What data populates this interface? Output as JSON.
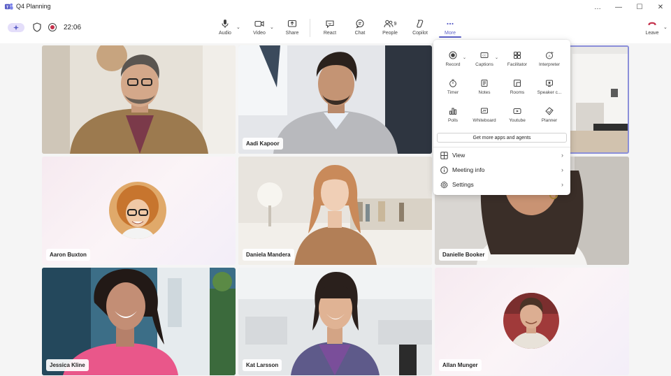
{
  "window": {
    "title": "Q4 Planning",
    "controls": [
      "…",
      "—",
      "☐",
      "✕"
    ]
  },
  "toolbar": {
    "timer": "22:06",
    "audio": "Audio",
    "video": "Video",
    "share": "Share",
    "react": "React",
    "chat": "Chat",
    "people": "People",
    "people_count": "9",
    "copilot": "Copilot",
    "more": "More",
    "leave": "Leave"
  },
  "more_menu": {
    "apps": [
      {
        "label": "Record",
        "icon": "record-icon"
      },
      {
        "label": "Captions",
        "icon": "captions-icon"
      },
      {
        "label": "Facilitator",
        "icon": "facilitator-icon"
      },
      {
        "label": "Interpreter",
        "icon": "interpreter-icon"
      },
      {
        "label": "Timer",
        "icon": "timer-icon"
      },
      {
        "label": "Notes",
        "icon": "notes-icon"
      },
      {
        "label": "Rooms",
        "icon": "rooms-icon"
      },
      {
        "label": "Speaker c...",
        "icon": "speaker-coach-icon"
      },
      {
        "label": "Polls",
        "icon": "polls-icon"
      },
      {
        "label": "Whiteboard",
        "icon": "whiteboard-icon"
      },
      {
        "label": "Youtube",
        "icon": "youtube-icon"
      },
      {
        "label": "Planner",
        "icon": "planner-icon"
      }
    ],
    "get_more": "Get more apps and agents",
    "rows": [
      {
        "label": "View",
        "icon": "view-icon"
      },
      {
        "label": "Meeting info",
        "icon": "info-icon"
      },
      {
        "label": "Settings",
        "icon": "settings-icon"
      }
    ]
  },
  "participants": [
    {
      "name": "",
      "type": "video"
    },
    {
      "name": "Aadi Kapoor",
      "type": "video"
    },
    {
      "name": "",
      "type": "video"
    },
    {
      "name": "Aaron Buxton",
      "type": "avatar"
    },
    {
      "name": "Daniela Mandera",
      "type": "video"
    },
    {
      "name": "Danielle Booker",
      "type": "video"
    },
    {
      "name": "Jessica Kline",
      "type": "video"
    },
    {
      "name": "Kat Larsson",
      "type": "video"
    },
    {
      "name": "Allan Munger",
      "type": "avatar"
    }
  ],
  "colors": {
    "accent": "#5b5fc7",
    "leave": "#c4314b",
    "copilot_pill": "#e4defa"
  }
}
